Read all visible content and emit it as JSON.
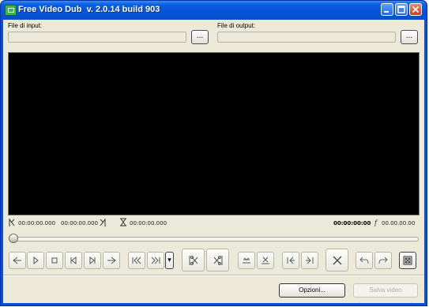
{
  "window": {
    "title": "Free Video Dub  v. 2.0.14 build 903"
  },
  "input": {
    "label": "File di input:",
    "value": "",
    "browse_label": "..."
  },
  "output": {
    "label": "File di output:",
    "value": "",
    "browse_label": "..."
  },
  "timecodes": {
    "mark_in": "00:00:00.000",
    "mark_out": "00:00:00.000",
    "selection": "00:00:00.000",
    "current": "00:00:00:00",
    "fps_symbol": "f",
    "duration": "00.00.00.00"
  },
  "seek": {
    "position": 0
  },
  "toolbar": {
    "dropdown_symbol": "▾"
  },
  "footer": {
    "options_label": "Opzioni...",
    "save_label": "Salva video"
  },
  "colors": {
    "titlebar": "#0454d8",
    "client": "#ece9d8",
    "video": "#000000"
  }
}
